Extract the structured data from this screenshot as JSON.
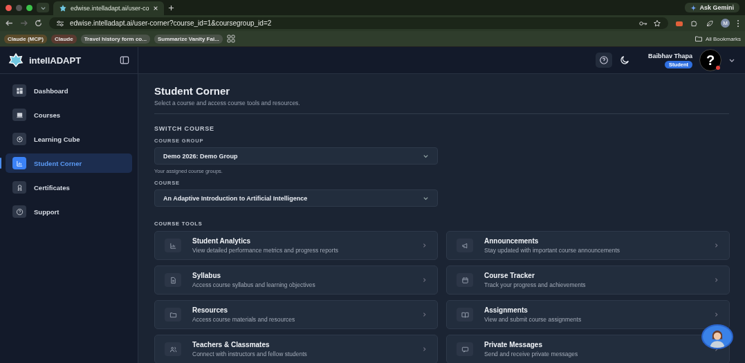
{
  "browser": {
    "tab_title": "edwise.intelladapt.ai/user-co",
    "url": "edwise.intelladapt.ai/user-corner?course_id=1&coursegroup_id=2",
    "ask_gemini": "Ask Gemini",
    "profile_initial": "M",
    "bookmarks": [
      {
        "label": "Claude (MCP)",
        "color": "#5a4a2a"
      },
      {
        "label": "Claude",
        "color": "#5a3a30"
      },
      {
        "label": "Travel history form co...",
        "color": "#4a5248"
      },
      {
        "label": "Summarize Vanity Fai...",
        "color": "#4a5248"
      }
    ],
    "all_bookmarks": "All Bookmarks"
  },
  "sidebar": {
    "brand": "intellADAPT",
    "items": [
      {
        "label": "Dashboard",
        "kind": "dashboard",
        "selected": false
      },
      {
        "label": "Courses",
        "kind": "courses",
        "selected": false
      },
      {
        "label": "Learning Cube",
        "kind": "cube",
        "selected": false
      },
      {
        "label": "Student Corner",
        "kind": "chart",
        "selected": true
      },
      {
        "label": "Certificates",
        "kind": "award",
        "selected": false
      },
      {
        "label": "Support",
        "kind": "help",
        "selected": false
      }
    ]
  },
  "topbar": {
    "user_name": "Baibhav Thapa",
    "role": "Student",
    "avatar": "?"
  },
  "page": {
    "title": "Student Corner",
    "subtitle": "Select a course and access course tools and resources.",
    "switch_heading": "SWITCH COURSE",
    "group_label": "COURSE GROUP",
    "group_value": "Demo 2026: Demo Group",
    "group_hint": "Your assigned course groups.",
    "course_label": "COURSE",
    "course_value": "An Adaptive Introduction to Artificial Intelligence",
    "tools_heading": "COURSE TOOLS",
    "tools": [
      {
        "title": "Student Analytics",
        "description": "View detailed performance metrics and progress reports",
        "kind": "chart"
      },
      {
        "title": "Announcements",
        "description": "Stay updated with important course announcements",
        "kind": "megaphone"
      },
      {
        "title": "Syllabus",
        "description": "Access course syllabus and learning objectives",
        "kind": "document"
      },
      {
        "title": "Course Tracker",
        "description": "Track your progress and achievements",
        "kind": "calendar"
      },
      {
        "title": "Resources",
        "description": "Access course materials and resources",
        "kind": "folder"
      },
      {
        "title": "Assignments",
        "description": "View and submit course assignments",
        "kind": "book"
      },
      {
        "title": "Teachers & Classmates",
        "description": "Connect with instructors and fellow students",
        "kind": "people"
      },
      {
        "title": "Private Messages",
        "description": "Send and receive private messages",
        "kind": "message"
      }
    ]
  }
}
